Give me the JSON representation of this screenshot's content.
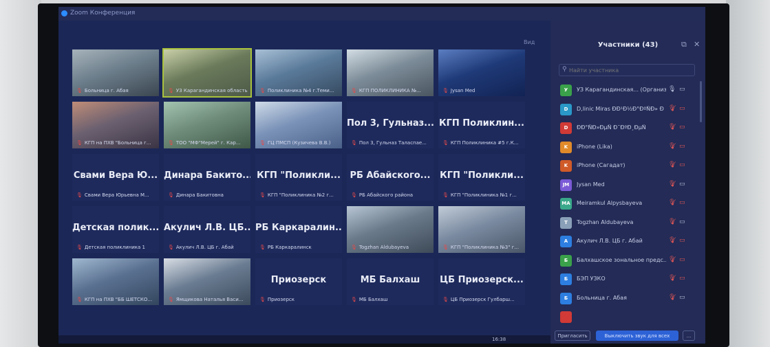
{
  "window": {
    "title": "Zoom Конференция",
    "view_label": "Вид",
    "controls": [
      "–",
      "◻",
      "✕"
    ]
  },
  "tiles": [
    {
      "id": "t1",
      "type": "video",
      "caption": "Больница г. Абая"
    },
    {
      "id": "t2",
      "type": "video",
      "caption": "УЗ Карагандинская область",
      "active": true
    },
    {
      "id": "t3",
      "type": "video",
      "caption": "Поликлиника №4 г.Теми..."
    },
    {
      "id": "t4",
      "type": "video",
      "caption": "КГП ПОЛИКЛИНИКА №..."
    },
    {
      "id": "t5",
      "type": "video",
      "caption": "Jysan Med"
    },
    {
      "id": "t6",
      "type": "video",
      "caption": "КГП на ПХВ \"Больница г..."
    },
    {
      "id": "t7",
      "type": "video",
      "caption": "ТОО \"МФ\"Мерей\" г. Кар..."
    },
    {
      "id": "t8",
      "type": "video",
      "caption": "ГЦ ПМСП (Кузичева В.В.)"
    },
    {
      "id": "t9",
      "type": "name",
      "big": "Пол 3, Гульназ...",
      "caption": "Пол 3, Гульназ Таласпае..."
    },
    {
      "id": "t10",
      "type": "name",
      "big": "КГП Поликлин...",
      "caption": "КГП Поликлиника #5 г.К..."
    },
    {
      "id": "t11",
      "type": "name",
      "big": "Свами Вера Ю...",
      "caption": "Свами Вера Юрьевна М..."
    },
    {
      "id": "t12",
      "type": "name",
      "big": "Динара Бакито...",
      "caption": "Динара Бакитовна"
    },
    {
      "id": "t13",
      "type": "name",
      "big": "КГП \"Поликли...",
      "caption": "КГП \"Поликлиника №2 г..."
    },
    {
      "id": "t14",
      "type": "name",
      "big": "РБ Абайского...",
      "caption": "РБ Абайского района"
    },
    {
      "id": "t15",
      "type": "name",
      "big": "КГП \"Поликли...",
      "caption": "КГП \"Поликлиника №1 г..."
    },
    {
      "id": "t16",
      "type": "name",
      "big": "Детская полик...",
      "caption": "Детская поликлиника 1"
    },
    {
      "id": "t17",
      "type": "name",
      "big": "Акулич Л.В. ЦБ...",
      "caption": "Акулич Л.В. ЦБ г. Абай"
    },
    {
      "id": "t18",
      "type": "name",
      "big": "РБ Каркаралин...",
      "caption": "РБ Каркаралинск"
    },
    {
      "id": "t19",
      "type": "video",
      "caption": "Togzhan Aldubayeva"
    },
    {
      "id": "t20",
      "type": "video",
      "caption": "КГП \"Поликлиника №3\" г..."
    },
    {
      "id": "t21",
      "type": "video",
      "caption": "КГП на ПХВ \"ББ ШЕТСКО..."
    },
    {
      "id": "t22",
      "type": "video",
      "caption": "Ямщикова Наталья Васи..."
    },
    {
      "id": "t23",
      "type": "name",
      "big": "Приозерск",
      "caption": "Приозерск"
    },
    {
      "id": "t24",
      "type": "name",
      "big": "МБ Балхаш",
      "caption": "МБ Балхаш"
    },
    {
      "id": "t25",
      "type": "name",
      "big": "ЦБ Приозерск...",
      "caption": "ЦБ Приозерск Гулбарш..."
    }
  ],
  "panel": {
    "title": "Участники (43)",
    "search_placeholder": "Найти участника",
    "popout_icon": "popout-icon",
    "participants": [
      {
        "initial": "У",
        "color": "#3aa14a",
        "name": "УЗ Карагандинская... (Организатор, я)",
        "mic": "on",
        "cam": "on"
      },
      {
        "initial": "D",
        "color": "#2a98c8",
        "name": "D,linic Miras ÐÐ¹Ð½Ð°ÐºÑÐ» Ð",
        "mic": "muted",
        "cam": "off"
      },
      {
        "initial": "D",
        "color": "#d13a36",
        "name": "ÐÐ°ÑÐ»ÐµÑ Ð¯ÐºÐ¸ÐµÑ",
        "mic": "muted",
        "cam": "off"
      },
      {
        "initial": "K",
        "color": "#e08a2a",
        "name": "iPhone (Lika)",
        "mic": "muted",
        "cam": "off"
      },
      {
        "initial": "K",
        "color": "#d05a28",
        "name": "iPhone (Сагадат)",
        "mic": "muted",
        "cam": "off"
      },
      {
        "initial": "JM",
        "color": "#7b5ad6",
        "name": "Jysan Med",
        "mic": "muted",
        "cam": "on"
      },
      {
        "initial": "MA",
        "color": "#3aa88a",
        "name": "Meiramkul Alpysbayeva",
        "mic": "muted",
        "cam": "off"
      },
      {
        "initial": "T",
        "color": "#8aa0b8",
        "name": "Togzhan Aldubayeva",
        "mic": "muted",
        "cam": "on"
      },
      {
        "initial": "A",
        "color": "#2d7ee0",
        "name": "Акулич Л.В. ЦБ г. Абай",
        "mic": "muted",
        "cam": "off"
      },
      {
        "initial": "Б",
        "color": "#3aa14a",
        "name": "Балхашское зональное предс...",
        "mic": "muted",
        "cam": "off"
      },
      {
        "initial": "Б",
        "color": "#2d7ee0",
        "name": "БЭП УЗКО",
        "mic": "muted",
        "cam": "off"
      },
      {
        "initial": "Б",
        "color": "#2d7ee0",
        "name": "Больница г. Абая",
        "mic": "muted",
        "cam": "on"
      },
      {
        "initial": "",
        "color": "#d13a36",
        "name": "",
        "mic": "",
        "cam": ""
      }
    ],
    "buttons": {
      "invite": "Пригласить",
      "mute_all": "Выключить звук для всех",
      "more": "..."
    }
  },
  "clock": "16:38"
}
